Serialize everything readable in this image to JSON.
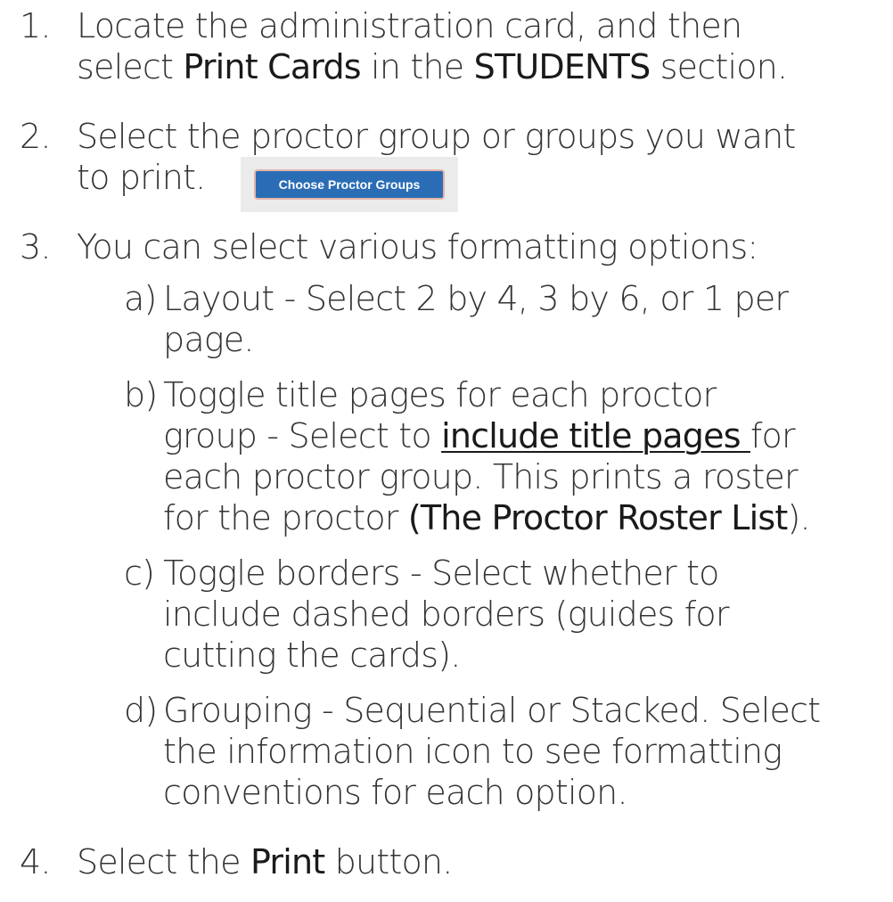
{
  "steps": [
    {
      "number": "1.",
      "line1_pre": "Locate the administration card, and then",
      "line2_pre": "select ",
      "line2_bold1": "Print Cards",
      "line2_mid": " in the ",
      "line2_bold2": "STUDENTS",
      "line2_post": " section."
    },
    {
      "number": "2.",
      "line1": "Select the proctor group or groups you want",
      "line2": "to print.",
      "button_label": "Choose Proctor Groups"
    },
    {
      "number": "3.",
      "line1": "You can select various formatting options:",
      "subs": [
        {
          "letter": "a)",
          "line1": "Layout - Select 2 by 4, 3 by 6, or 1 per",
          "line2": "page."
        },
        {
          "letter": "b)",
          "line1": "Toggle title pages for each proctor",
          "line2_pre": "group - Select to ",
          "line2_link": "include title pages ",
          "line2_post": "for",
          "line3": "each proctor group. This prints a roster",
          "line4_pre": "for the proctor ",
          "line4_bold": "(The Proctor Roster List",
          "line4_post": ")."
        },
        {
          "letter": "c)",
          "line1": "Toggle borders - Select whether to",
          "line2": "include dashed borders (guides for",
          "line3": "cutting the cards)."
        },
        {
          "letter": "d)",
          "line1": "Grouping - Sequential or Stacked. Select",
          "line2": "the information icon to see formatting",
          "line3": "conventions for each option."
        }
      ]
    },
    {
      "number": "4.",
      "pre": "Select the ",
      "bold": "Print",
      "post": " button."
    }
  ],
  "colors": {
    "text": "#333333",
    "button_bg": "#2a6db5",
    "button_border": "#e3b4a8",
    "button_frame": "#ebebeb"
  }
}
